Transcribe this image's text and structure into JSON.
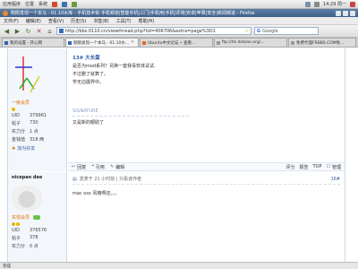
{
  "gnome_panel": {
    "applications": "应用程序",
    "places": "位置",
    "system": "系统",
    "clock": "14:29 周一"
  },
  "window": {
    "title": "刚刚发现一个本马 - 01.10水库 - 手机技术街 手机频道|智能手机|三门|手机用|手机|评测|安卓|苹果|安全|新闻频道 - Firefox"
  },
  "menu": [
    "文件(F)",
    "编辑(E)",
    "查看(V)",
    "历史(S)",
    "书签(B)",
    "工具(T)",
    "帮助(H)"
  ],
  "nav": {
    "back": "◀",
    "forward": "▶",
    "reload": "↻",
    "stop": "✕",
    "home": "⌂",
    "url": "http://bbs.0110.cn/viewthread.php?tid=406706&extra=page%3D1",
    "search_placeholder": "Google"
  },
  "tabs": [
    {
      "label": "我的设置 - 开心网",
      "active": false
    },
    {
      "label": "刚刚发现一个本马 - 01.10水...",
      "active": true
    },
    {
      "label": "Ubuntu中文论坛 • 查看...",
      "active": false
    },
    {
      "label": "ftp://hk.debian.org/...",
      "active": false
    },
    {
      "label": "免费代理FRBBS.COM免...",
      "active": false
    }
  ],
  "post1": {
    "title": "13# 大长蛋",
    "lines": [
      "是否为mod系列？另换一套我毒软体试试.",
      "不过删了就算了。",
      "学无边疆界中。"
    ],
    "signature": "SIGNATURE",
    "signature_text": "又是新的眼助了",
    "user": {
      "title": "一级会员",
      "uid_label": "UID",
      "uid": "379961",
      "posts_label": "帖子",
      "posts": "730",
      "power_label": "实力分",
      "power": "1 点",
      "coin_label": "金钱值",
      "coin": "318 两",
      "add_friend": "加为好友"
    }
  },
  "actions": {
    "reply": "回复",
    "quote": "引用",
    "edit": "编辑",
    "rate": "评分",
    "report": "报告",
    "top": "TOP",
    "manage": "管理"
  },
  "post2": {
    "username": "nicepan dee",
    "meta": "发表于 21 小时前  |  只看该作者",
    "floor": "16#",
    "content": "mac osx 风格啊还。。。",
    "user": {
      "title": "实现会员",
      "uid_label": "UID",
      "uid": "376576",
      "posts_label": "帖子",
      "posts": "378",
      "power_label": "实力分",
      "power": "0 点"
    }
  },
  "status": "完成",
  "colors": {
    "link": "#2b58a8",
    "user_title": "#e07000",
    "signature": "#8aa2c8"
  }
}
